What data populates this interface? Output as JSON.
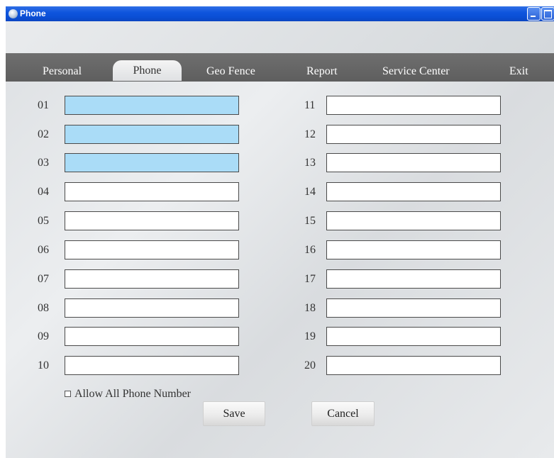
{
  "window": {
    "title": "Phone"
  },
  "tabs": [
    {
      "label": "Personal",
      "active": false
    },
    {
      "label": "Phone",
      "active": true
    },
    {
      "label": "Geo Fence",
      "active": false
    },
    {
      "label": "Report",
      "active": false
    },
    {
      "label": "Service Center",
      "active": false
    },
    {
      "label": "Exit",
      "active": false
    }
  ],
  "phone_fields": {
    "left": [
      {
        "label": "01",
        "value": "",
        "highlighted": true
      },
      {
        "label": "02",
        "value": "",
        "highlighted": true
      },
      {
        "label": "03",
        "value": "",
        "highlighted": true
      },
      {
        "label": "04",
        "value": "",
        "highlighted": false
      },
      {
        "label": "05",
        "value": "",
        "highlighted": false
      },
      {
        "label": "06",
        "value": "",
        "highlighted": false
      },
      {
        "label": "07",
        "value": "",
        "highlighted": false
      },
      {
        "label": "08",
        "value": "",
        "highlighted": false
      },
      {
        "label": "09",
        "value": "",
        "highlighted": false
      },
      {
        "label": "10",
        "value": "",
        "highlighted": false
      }
    ],
    "right": [
      {
        "label": "11",
        "value": ""
      },
      {
        "label": "12",
        "value": ""
      },
      {
        "label": "13",
        "value": ""
      },
      {
        "label": "14",
        "value": ""
      },
      {
        "label": "15",
        "value": ""
      },
      {
        "label": "16",
        "value": ""
      },
      {
        "label": "17",
        "value": ""
      },
      {
        "label": "18",
        "value": ""
      },
      {
        "label": "19",
        "value": ""
      },
      {
        "label": "20",
        "value": ""
      }
    ]
  },
  "allow_all": {
    "label": "Allow All Phone Number",
    "checked": false
  },
  "buttons": {
    "save": "Save",
    "cancel": "Cancel"
  },
  "colors": {
    "title_bar": "#0a4fd6",
    "tab_bar": "#676767",
    "highlighted_field": "#aadcf7"
  }
}
